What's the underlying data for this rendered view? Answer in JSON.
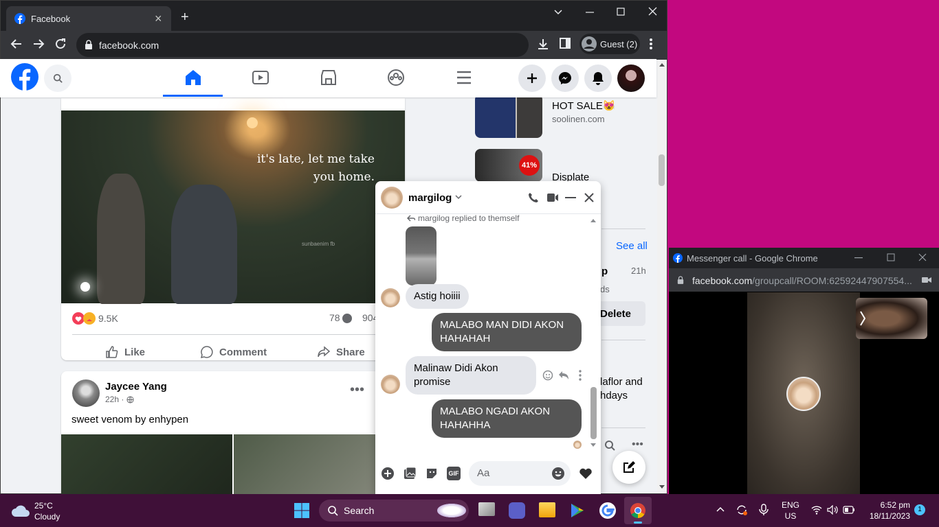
{
  "browser": {
    "tab_title": "Facebook",
    "close_tab": "×",
    "new_tab": "+",
    "url": "facebook.com",
    "profile": "Guest (2)"
  },
  "post1": {
    "image_caption_line1": "it's late, let me take",
    "image_caption_line2": "you home.",
    "watermark": "sunbaenim fb",
    "reactions": "9.5K",
    "comments": "78",
    "shares": "904",
    "like": "Like",
    "comment": "Comment",
    "share": "Share"
  },
  "post2": {
    "author": "Jaycee Yang",
    "time": "22h ·",
    "text": "sweet venom by enhypen",
    "more": "•••"
  },
  "sidebar": {
    "ad1_title": "HOT SALE😻",
    "ad1_site": "soolinen.com",
    "ad2_badge": "41%",
    "ad2_title": "Displate",
    "see_all": "See all",
    "request_name": "p",
    "request_time": "21h",
    "request_sub": "ds",
    "delete": "Delete",
    "birthday_line1": "laflor and",
    "birthday_line2": "hdays",
    "more": "•••"
  },
  "chat": {
    "name": "margilog",
    "replied": "margilog replied to themself",
    "msg1": "Astig hoiiii",
    "msg2": "MALABO MAN DIDI AKON HAHAHAH",
    "msg3": "Malinaw Didi Akon promise",
    "msg4": "MALABO NGADI AKON HAHAHHA",
    "input_placeholder": "Aa",
    "gif": "GIF"
  },
  "call_window": {
    "title": "Messenger call - Google Chrome",
    "url_domain": "facebook.com",
    "url_path": "/groupcall/ROOM:62592447907554..."
  },
  "taskbar": {
    "temp": "25°C",
    "weather": "Cloudy",
    "search": "Search",
    "lang1": "ENG",
    "lang2": "US",
    "time": "6:52 pm",
    "date": "18/11/2023",
    "notifications": "1"
  },
  "colors": {
    "fb_blue": "#0866ff",
    "desktop": "#c2087f",
    "outgoing_bubble": "#555555",
    "taskbar": "#3f1038"
  }
}
